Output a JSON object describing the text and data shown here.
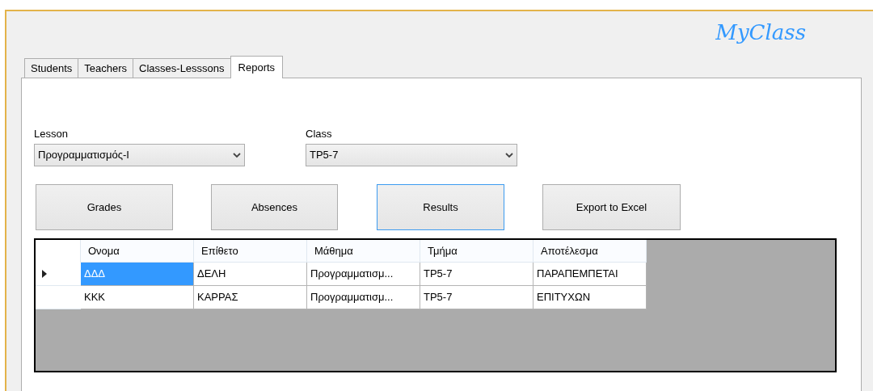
{
  "logo": "MyClass",
  "tabs": [
    {
      "label": "Students",
      "selected": false
    },
    {
      "label": "Teachers",
      "selected": false
    },
    {
      "label": "Classes-Lesssons",
      "selected": false
    },
    {
      "label": "Reports",
      "selected": true
    }
  ],
  "filters": [
    {
      "label": "Lesson",
      "value": "Προγραμματισμός-Ι"
    },
    {
      "label": "Class",
      "value": "ΤΡ5-7"
    }
  ],
  "buttons": [
    {
      "label": "Grades",
      "focused": false
    },
    {
      "label": "Absences",
      "focused": false
    },
    {
      "label": "Results",
      "focused": true
    },
    {
      "label": "Export to Excel",
      "focused": false
    }
  ],
  "table": {
    "columns": [
      "Ονομα",
      "Επίθετο",
      "Μάθημα",
      "Τμήμα",
      "Αποτέλεσμα"
    ],
    "rows": [
      {
        "selected": true,
        "cells": [
          "ΔΔΔ",
          "ΔΕΛΗ",
          "Προγραμματισμ...",
          "ΤΡ5-7",
          "ΠΑΡΑΠΕΜΠΕΤΑΙ"
        ]
      },
      {
        "selected": false,
        "cells": [
          "ΚΚΚ",
          "ΚΑΡΡΑΣ",
          "Προγραμματισμ...",
          "ΤΡ5-7",
          "ΕΠΙΤΥΧΩΝ"
        ]
      }
    ]
  }
}
